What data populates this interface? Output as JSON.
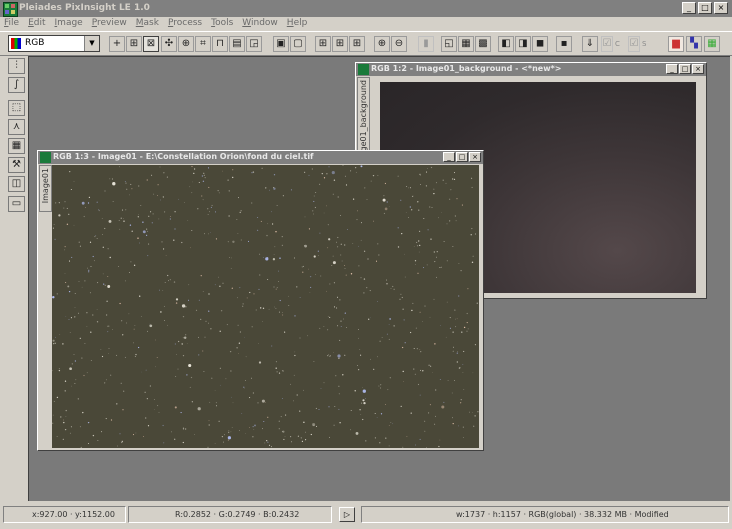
{
  "app": {
    "title": "Pleiades PixInsight LE 1.0",
    "window_buttons": [
      "_",
      "□",
      "×"
    ]
  },
  "menu": [
    "File",
    "Edit",
    "Image",
    "Preview",
    "Mask",
    "Process",
    "Tools",
    "Window",
    "Help"
  ],
  "toolbar": {
    "color_space": "RGB",
    "check_labels": [
      "C",
      "S"
    ]
  },
  "windows": {
    "background": {
      "title": "RGB 1:2 - Image01_background - <*new*>",
      "tab_label": "Image01_background"
    },
    "orion": {
      "title": "RGB 1:3 - Image01 - E:\\Constellation Orion\\fond du ciel.tif",
      "tab_label": "Image01"
    }
  },
  "status": {
    "coords": "x:927.00 · y:1152.00",
    "values": "R:0.2852 · G:0.2749 · B:0.2432",
    "info": "w:1737 · h:1157 · RGB(global) · 38.332 MB · Modified"
  },
  "icons": {
    "toolbar": [
      "cursor-icon",
      "zoom-icon",
      "fit-icon",
      "pan-icon",
      "crosshair-icon",
      "crop-icon",
      "new-preview-icon",
      "preview-icon",
      "zoom-window-icon",
      "window-restore-icon",
      "window-fit-icon",
      "zoom-1-icon",
      "zoom-2-icon",
      "zoom-3-icon",
      "expand-icon",
      "shrink-icon",
      "mask-show-icon",
      "mask-invert-icon",
      "mask-enable-icon",
      "mask-color-icon",
      "channel-r-icon",
      "channel-g-icon",
      "channel-b-icon",
      "stf-icon",
      "check-c-icon",
      "check-s-icon",
      "histogram-icon",
      "rgb-palette-icon",
      "color-grid-icon"
    ],
    "left": [
      "histogram-icon",
      "curves-icon",
      "selection-icon",
      "star-icon",
      "grid-icon",
      "tools-icon",
      "process-icon",
      "console-icon"
    ]
  },
  "colors": {
    "workspace": "#7a7a7a",
    "titlebar": "#808080",
    "face": "#d4d0c8"
  }
}
